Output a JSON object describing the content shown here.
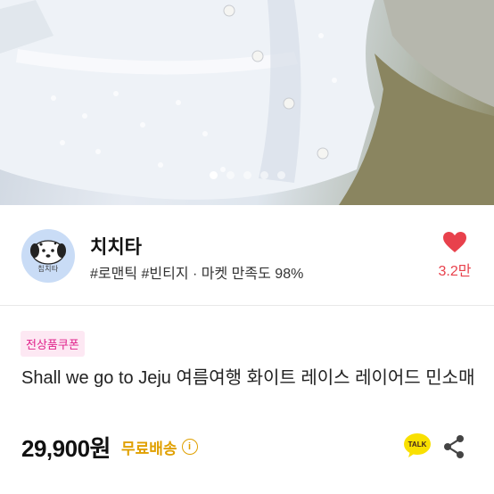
{
  "carousel": {
    "total": 5,
    "active_index": 0
  },
  "shop": {
    "name": "치치타",
    "avatar_text": "칩치타",
    "tags": "#로맨틱 #빈티지",
    "separator": "·",
    "satisfaction_label": "마켓 만족도",
    "satisfaction_value": "98%",
    "like_count": "3.2만"
  },
  "product": {
    "coupon_badge": "전상품쿠폰",
    "title": "Shall we go to Jeju 여름여행 화이트 레이스 레이어드 민소매",
    "price": "29,900원",
    "shipping": "무료배송",
    "info_icon": "i"
  },
  "actions": {
    "talk_label": "TALK",
    "share_icon": "share-icon"
  },
  "colors": {
    "accent_red": "#e8414c",
    "coupon_pink": "#e0218b",
    "coupon_bg": "#fde8f3",
    "shipping_yellow": "#e0a000",
    "talk_yellow": "#f9e000"
  }
}
